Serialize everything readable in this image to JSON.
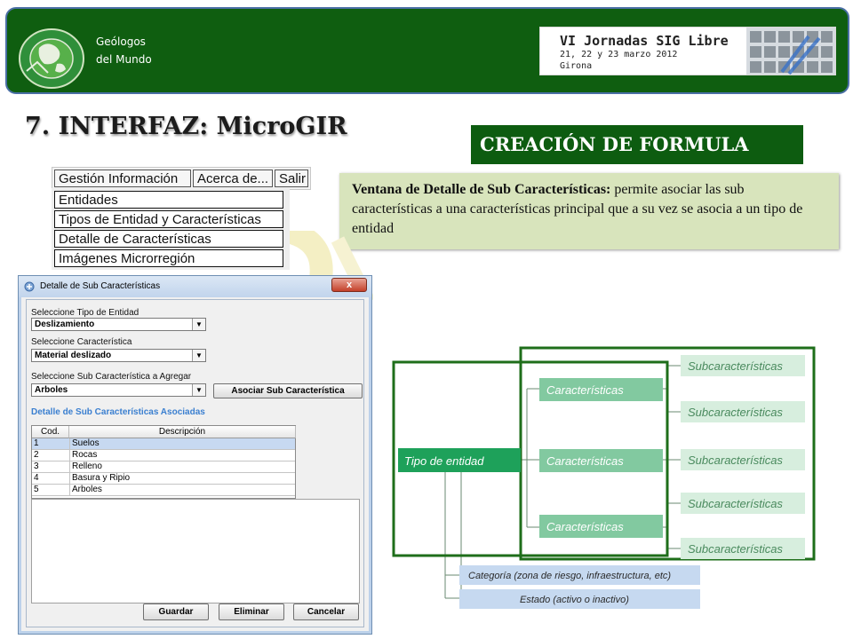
{
  "header": {
    "org_line1": "Geólogos",
    "org_line2": "del Mundo",
    "banner": {
      "title": "VI Jornadas SIG Libre",
      "dates": "21, 22 y 23 marzo 2012",
      "city": "Girona"
    }
  },
  "page_title": "7. INTERFAZ: MicroGIR",
  "section_title": "CREACIÓN DE FORMULA",
  "description": {
    "bold": "Ventana de Detalle de Sub Características:",
    "text": " permite asociar las sub características a una características principal que a su vez se  asocia a un tipo de entidad"
  },
  "menu": {
    "tabs": [
      "Gestión Información",
      "Acerca de...",
      "Salir"
    ],
    "items": [
      "Entidades",
      "Tipos de Entidad y Características",
      "Detalle de Características",
      "Imágenes Microrregión"
    ]
  },
  "dialog": {
    "title": "Detalle de Sub Características",
    "close_glyph": "x",
    "entity_label": "Seleccione Tipo de Entidad",
    "entity_value": "Deslizamiento",
    "feature_label": "Seleccione Característica",
    "feature_value": "Material deslizado",
    "sub_label": "Seleccione Sub Característica a Agregar",
    "sub_value": "Arboles",
    "associate_button": "Asociar Sub Característica",
    "table_title": "Detalle de Sub Características Asociadas",
    "columns": [
      "Cod.",
      "Descripción"
    ],
    "rows": [
      {
        "code": "1",
        "desc": "Suelos"
      },
      {
        "code": "2",
        "desc": "Rocas"
      },
      {
        "code": "3",
        "desc": "Relleno"
      },
      {
        "code": "4",
        "desc": "Basura y Ripio"
      },
      {
        "code": "5",
        "desc": "Arboles"
      }
    ],
    "buttons": {
      "save": "Guardar",
      "delete": "Eliminar",
      "cancel": "Cancelar"
    }
  },
  "diagram": {
    "root": "Tipo de entidad",
    "characteristic": "Características",
    "subcharacteristic": "Subcaracterísticas",
    "category": "Categoría (zona de riesgo, infraestructura, etc)",
    "state": "Estado (activo o inactivo)"
  },
  "colors": {
    "header_green": "#0f5e10",
    "box_green": "#1ea15a",
    "light_green": "#82c9a0",
    "pale_green": "#d7eede",
    "pale_blue": "#c6d9f0",
    "frame_green": "#1e6e1a",
    "desc_bg": "#d8e4bc"
  }
}
